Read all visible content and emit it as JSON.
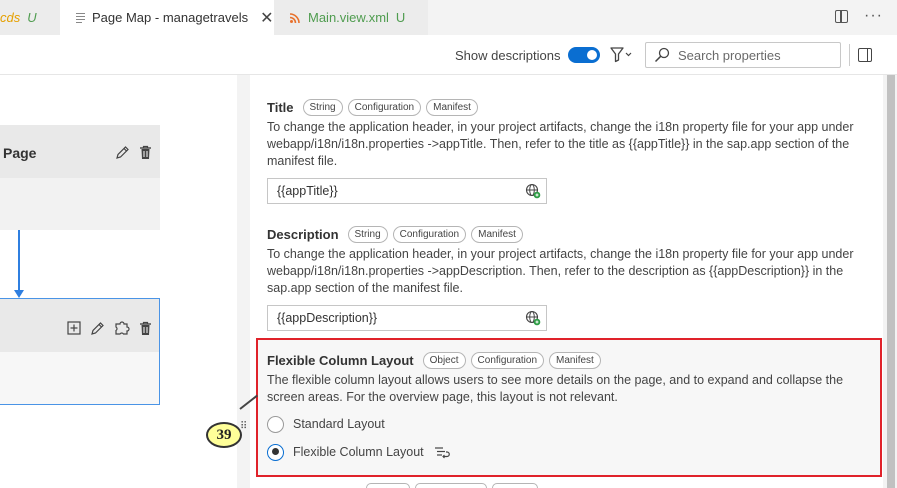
{
  "tabs": [
    {
      "label": "cds",
      "modified": "U"
    },
    {
      "label": "Page Map - managetravels",
      "close": "✕"
    },
    {
      "label": "Main.view.xml",
      "modified": "U"
    }
  ],
  "toolbar": {
    "show_descriptions_label": "Show descriptions",
    "show_descriptions_on": true,
    "search_placeholder": "Search properties"
  },
  "canvas": {
    "node1_title": "Page"
  },
  "properties": [
    {
      "name": "Title",
      "chips": [
        "String",
        "Configuration",
        "Manifest"
      ],
      "description": "To change the application header, in your project artifacts, change the i18n property file for your app under webapp/i18n/i18n.properties ->appTitle. Then, refer to the title as {{appTitle}} in the sap.app section of the manifest file.",
      "value": "{{appTitle}}"
    },
    {
      "name": "Description",
      "chips": [
        "String",
        "Configuration",
        "Manifest"
      ],
      "description": "To change the application header, in your project artifacts, change the i18n property file for your app under webapp/i18n/i18n.properties ->appDescription. Then, refer to the description as {{appDescription}} in the sap.app section of the manifest file.",
      "value": "{{appDescription}}"
    }
  ],
  "fcl": {
    "name": "Flexible Column Layout",
    "chips": [
      "Object",
      "Configuration",
      "Manifest"
    ],
    "description": "The flexible column layout allows users to see more details on the page, and to expand and collapse the screen areas. For the overview page, this layout is not relevant.",
    "options": [
      {
        "label": "Standard Layout",
        "checked": false
      },
      {
        "label": "Flexible Column Layout",
        "checked": true
      }
    ]
  },
  "annotation_badge": "39",
  "colors": {
    "accent": "#0a6ed1",
    "highlight_border": "#e0222a",
    "connector": "#2f7fe0",
    "badge_fill": "#ffff99"
  }
}
